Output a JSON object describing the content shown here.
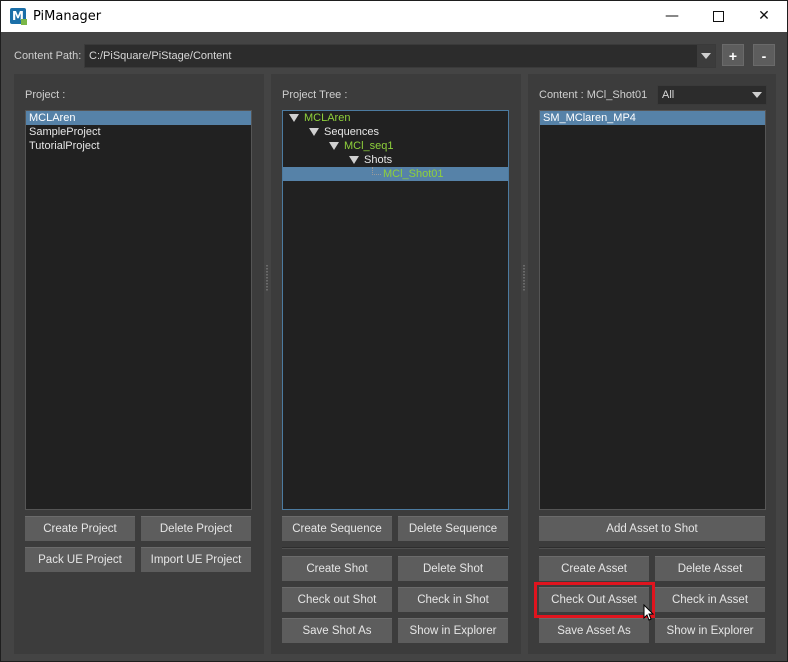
{
  "window": {
    "title": "PiManager",
    "minimize": "—",
    "close": "✕"
  },
  "content_path": {
    "label": "Content Path:",
    "value": "C:/PiSquare/PiStage/Content",
    "add": "+",
    "remove": "-"
  },
  "project_panel": {
    "label": "Project :",
    "items": [
      "MCLAren",
      "SampleProject",
      "TutorialProject"
    ],
    "selected": 0,
    "buttons": [
      "Create Project",
      "Delete Project",
      "Pack UE Project",
      "Import UE Project"
    ]
  },
  "tree_panel": {
    "label": "Project Tree :",
    "nodes": [
      {
        "text": "MCLAren",
        "level": 0
      },
      {
        "text": "Sequences",
        "level": 1
      },
      {
        "text": "MCl_seq1",
        "level": 2
      },
      {
        "text": "Shots",
        "level": 3
      },
      {
        "text": "MCl_Shot01",
        "level": 4
      }
    ],
    "colors": {
      "green": "#8fd13b",
      "selection": "#5682a8"
    },
    "buttons": [
      "Create Sequence",
      "Delete Sequence",
      "Create Shot",
      "Delete Shot",
      "Check out Shot",
      "Check in Shot",
      "Save Shot As",
      "Show in Explorer"
    ]
  },
  "content_panel": {
    "label": "Content : MCl_Shot01",
    "filter": "All",
    "items": [
      "SM_MClaren_MP4"
    ],
    "selected": 0,
    "buttons": [
      "Add Asset to Shot",
      "Create Asset",
      "Delete Asset",
      "Check Out Asset",
      "Check in Asset",
      "Save Asset As",
      "Show in Explorer"
    ],
    "highlight_color": "#e0141e"
  }
}
